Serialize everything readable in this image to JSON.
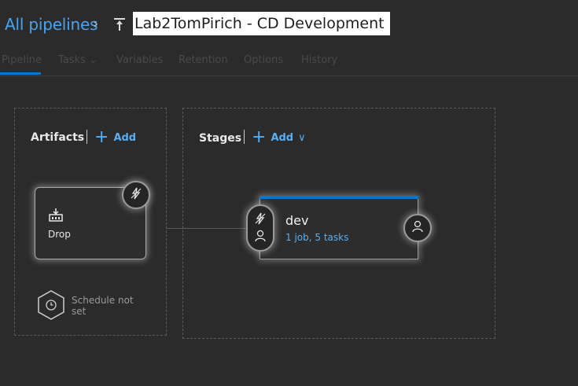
{
  "header": {
    "breadcrumb_link": "All pipelines",
    "separator_icon": "chevron-right-icon",
    "pipeline_icon": "release-pipeline-icon",
    "pipeline_title": "Lab2TomPirich - CD Development"
  },
  "tabs": [
    {
      "label": "Pipeline",
      "active": true
    },
    {
      "label": "Tasks",
      "has_dropdown": true
    },
    {
      "label": "Variables"
    },
    {
      "label": "Retention"
    },
    {
      "label": "Options"
    },
    {
      "label": "History"
    }
  ],
  "artifacts": {
    "title": "Artifacts",
    "add_label": "Add",
    "items": [
      {
        "name": "Drop",
        "icon": "build-artifact-icon",
        "trigger_icon": "lightning-trigger-icon"
      }
    ],
    "schedule": {
      "text": "Schedule not set",
      "icon": "clock-icon"
    }
  },
  "stages": {
    "title": "Stages",
    "add_label": "Add",
    "items": [
      {
        "name": "dev",
        "summary": "1 job, 5 tasks",
        "pre_deployment_icons": [
          "lightning-trigger-icon",
          "person-approval-icon"
        ],
        "post_deployment_icon": "person-approval-icon"
      }
    ]
  },
  "colors": {
    "background": "#2b2b2b",
    "accent": "#0078d4",
    "link": "#4aa3f0"
  }
}
